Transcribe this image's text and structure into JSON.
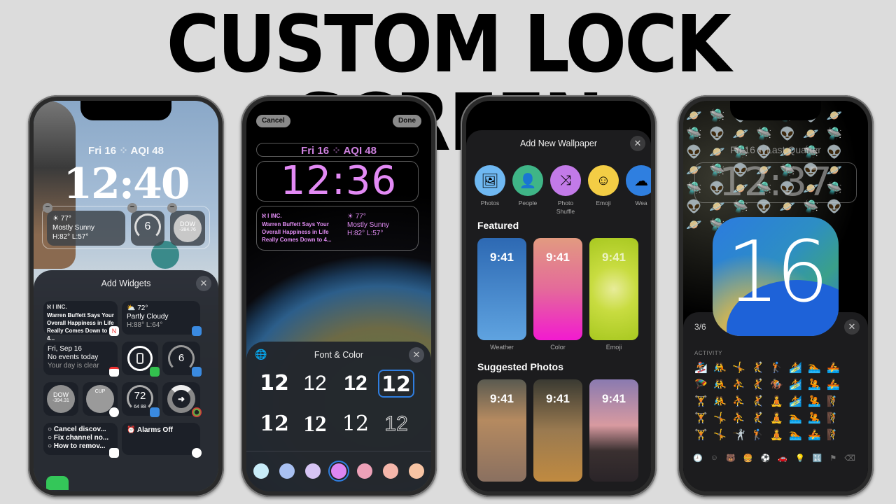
{
  "headline": "CUSTOM LOCK SCREEN",
  "phone1": {
    "lock_date": "Fri 16",
    "aqi": "AQI 48",
    "time": "12:40",
    "weather_widget": {
      "temp": "☀ 77°",
      "condition": "Mostly Sunny",
      "hilo": "H:82° L:57°"
    },
    "uv_widget": {
      "value": "6"
    },
    "stock_widget": {
      "symbol": "DOW",
      "change": "-384.76"
    },
    "sheet_title": "Add Widgets",
    "close": "✕",
    "tiles": {
      "news": {
        "source": "ℵ I INC.",
        "headline": "Warren Buffett Says Your Overall Happiness in Life Really Comes Down to 4..."
      },
      "weather": {
        "temp": "72°",
        "condition": "Partly Cloudy",
        "hilo": "H:88° L:64°"
      },
      "calendar": {
        "date": "Fri, Sep 16",
        "line1": "No events today",
        "line2": "Your day is clear"
      },
      "uv": {
        "value": "6"
      },
      "stock": {
        "symbol": "DOW",
        "change": "-394.31"
      },
      "clock": {
        "city": "CUP"
      },
      "temp_gauge": {
        "value": "72",
        "low": "64",
        "high": "88"
      },
      "reminders": [
        "Cancel discov...",
        "Fix channel no...",
        "How to remov..."
      ],
      "alarm": {
        "label": "Alarms Off"
      }
    }
  },
  "phone2": {
    "cancel": "Cancel",
    "done": "Done",
    "lock_date": "Fri 16",
    "aqi": "AQI 48",
    "time": "12:36",
    "news": {
      "source": "ℵ I INC.",
      "headline": "Warren Buffett Says Your Overall Happiness in Life Really Comes Down to 4..."
    },
    "weather": {
      "temp": "☀ 77°",
      "condition": "Mostly Sunny",
      "hilo": "H:82° L:57°"
    },
    "sheet_title": "Font & Color",
    "close": "✕",
    "font_samples": [
      "12",
      "12",
      "12",
      "12",
      "12",
      "12",
      "12",
      "12"
    ],
    "selected_font_index": 3,
    "swatches": [
      "#c8ecf8",
      "#a9c1f2",
      "#d6c4f4",
      "#dd86f2",
      "#eda1b8",
      "#f5b6aa",
      "#f7c4a4"
    ],
    "selected_swatch_index": 3
  },
  "phone3": {
    "sheet_title": "Add New Wallpaper",
    "close": "✕",
    "categories": [
      {
        "label": "Photos",
        "icon": "🖼",
        "color": "#6fb8f2"
      },
      {
        "label": "People",
        "icon": "👤",
        "color": "#3fb587"
      },
      {
        "label": "Photo Shuffle",
        "icon": "⤨",
        "color": "#c27ae8"
      },
      {
        "label": "Emoji",
        "icon": "☺",
        "color": "#f3cd45"
      },
      {
        "label": "Wea",
        "icon": "☁",
        "color": "#2f7fe0"
      }
    ],
    "featured_title": "Featured",
    "featured": [
      {
        "label": "Weather",
        "time": "9:41"
      },
      {
        "label": "Color",
        "time": "9:41"
      },
      {
        "label": "Emoji",
        "time": "9:41"
      }
    ],
    "suggested_title": "Suggested Photos",
    "suggested": [
      {
        "time": "9:41"
      },
      {
        "time": "9:41"
      },
      {
        "time": "9:41"
      }
    ]
  },
  "phone4": {
    "lock_date": "Fri 16",
    "moon": "Last Quarter",
    "time": "12:37",
    "ios_badge": "16",
    "page_indicator": "3/6",
    "close": "✕",
    "category": "ACTIVITY",
    "emoji_rows": [
      [
        "🏂",
        "🤼",
        "🤸",
        "🤾",
        "🏌",
        "🏄",
        "🏊",
        "🚣"
      ],
      [
        "🪂",
        "🤼",
        "⛹",
        "🤾",
        "🏇",
        "🏄",
        "🤽",
        "🚣"
      ],
      [
        "🏋",
        "🤼",
        "⛹",
        "🤾",
        "🧘",
        "🏄",
        "🤽",
        "🧗"
      ],
      [
        "🏋",
        "🤸",
        "⛹",
        "🤾",
        "🧘",
        "🏊",
        "🤽",
        "🧗"
      ],
      [
        "🏋",
        "🤸",
        "🤺",
        "🏌",
        "🧘",
        "🏊",
        "🚣",
        "🧗"
      ]
    ],
    "kb_icons": [
      "🕘",
      "☺",
      "🐻",
      "🍔",
      "⚽",
      "🚗",
      "💡",
      "🔣",
      "⚑",
      "⌫"
    ]
  }
}
